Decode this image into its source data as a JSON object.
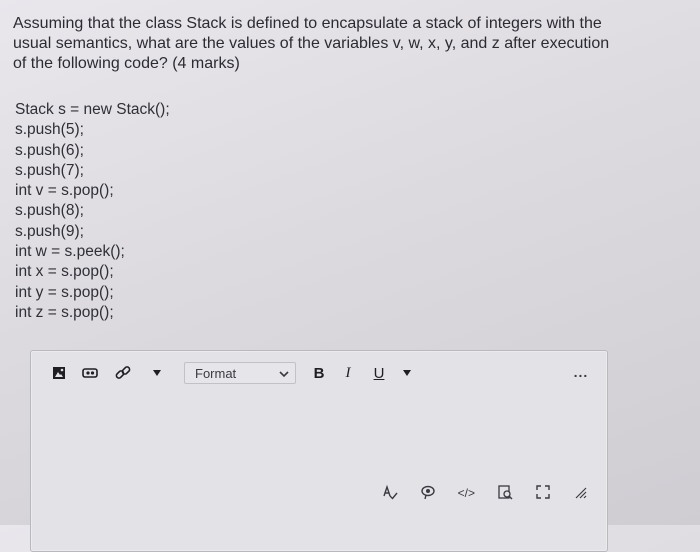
{
  "question": {
    "line1": "Assuming that the class Stack is defined to encapsulate a stack of integers with the",
    "line2": "usual semantics, what are the values of the variables v, w, x, y, and z after execution",
    "line3": "of the following code? (4 marks)"
  },
  "code_lines": [
    "Stack s = new Stack();",
    "s.push(5);",
    "s.push(6);",
    "s.push(7);",
    "int v = s.pop();",
    "s.push(8);",
    "s.push(9);",
    "int w = s.peek();",
    "int x = s.pop();",
    "int y = s.pop();",
    "int z = s.pop();"
  ],
  "editor": {
    "format_label": "Format",
    "bold_label": "B",
    "italic_label": "I",
    "underline_label": "U",
    "more_label": "...",
    "code_view_label": "</>"
  },
  "icons": {
    "image": "image-icon",
    "media": "media-icon",
    "link": "link-icon",
    "dropdown": "chevron-down-icon",
    "spellcheck": "spellcheck-icon",
    "accessibility": "accessibility-icon",
    "code_view": "code-view-icon",
    "find_replace": "find-replace-icon",
    "fullscreen": "fullscreen-icon",
    "resize": "resize-handle-icon"
  }
}
